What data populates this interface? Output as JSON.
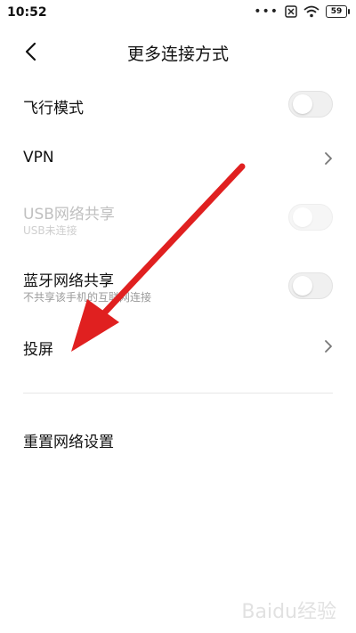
{
  "status_bar": {
    "time": "10:52",
    "dots": "•••",
    "battery": "59"
  },
  "header": {
    "title": "更多连接方式"
  },
  "rows": [
    {
      "id": "airplane",
      "label": "飞行模式",
      "control": "toggle",
      "on": false
    },
    {
      "id": "vpn",
      "label": "VPN",
      "control": "chevron"
    },
    {
      "id": "usb",
      "label": "USB网络共享",
      "sub": "USB未连接",
      "control": "toggle",
      "on": false,
      "disabled": true
    },
    {
      "id": "bluetooth",
      "label": "蓝牙网络共享",
      "sub": "不共享该手机的互联网连接",
      "control": "toggle",
      "on": false
    },
    {
      "id": "cast",
      "label": "投屏",
      "control": "chevron"
    },
    {
      "id": "reset",
      "label": "重置网络设置",
      "control": "none"
    }
  ],
  "annotation": {
    "arrow_color": "#e02020"
  },
  "watermark": "Baidu经验"
}
